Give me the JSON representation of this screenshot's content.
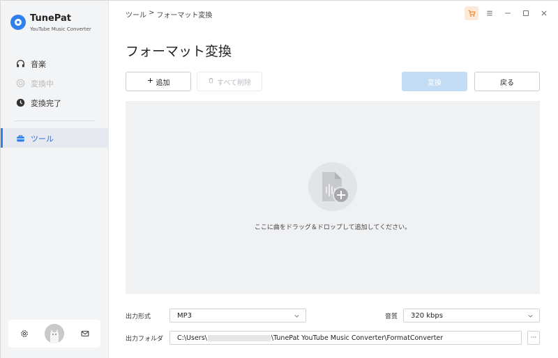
{
  "app": {
    "name": "TunePat",
    "subtitle": "YouTube Music Converter"
  },
  "sidebar": {
    "items": [
      {
        "label": "音楽",
        "icon": "headphones-icon",
        "state": "normal"
      },
      {
        "label": "変換中",
        "icon": "converting-icon",
        "state": "disabled"
      },
      {
        "label": "変換完了",
        "icon": "clock-icon",
        "state": "normal"
      },
      {
        "label": "ツール",
        "icon": "toolbox-icon",
        "state": "active"
      }
    ]
  },
  "breadcrumb": {
    "parent": "ツール",
    "separator": ">",
    "current": "フォーマット変換"
  },
  "page": {
    "title": "フォーマット変換"
  },
  "toolbar": {
    "add_label": "追加",
    "delete_all_label": "すべて削除",
    "convert_label": "変換",
    "back_label": "戻る"
  },
  "dropzone": {
    "hint": "ここに曲をドラッグ＆ドロップして追加してください。"
  },
  "settings": {
    "output_format_label": "出力形式",
    "output_format_value": "MP3",
    "quality_label": "音質",
    "quality_value": "320 kbps",
    "output_folder_label": "出力フォルダ",
    "output_folder_prefix": "C:\\Users\\",
    "output_folder_suffix": "\\TunePat YouTube Music Converter\\FormatConverter",
    "more_label": "···"
  },
  "colors": {
    "accent": "#2f80ed",
    "convert_disabled": "#c3dcf6",
    "cart_bg": "#fde9d8",
    "cart_icon": "#f08a3c"
  }
}
